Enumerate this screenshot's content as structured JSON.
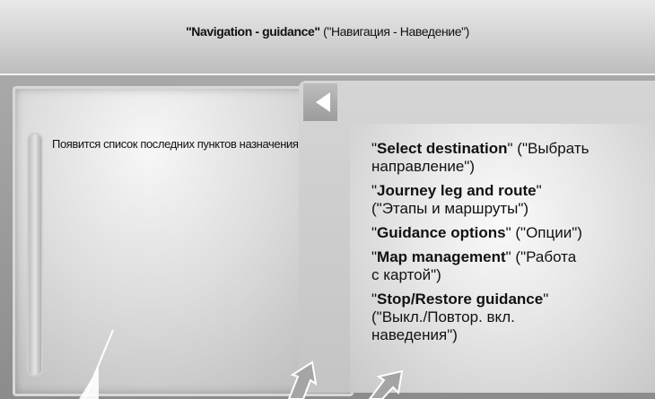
{
  "header": {
    "title_main": "\"Navigation - guidance\"",
    "title_sub": "(\"Навигация - Наведение\")"
  },
  "left_panel": {
    "text": "Появится список последних пунктов назначения."
  },
  "menu": {
    "items": [
      {
        "key": "Select destination",
        "line1_tail": " (\"Выбрать",
        "line2": "направление\")"
      },
      {
        "key": "Journey leg and route",
        "line1_tail": "",
        "line2": "(\"Этапы и маршруты\")"
      },
      {
        "key": "Guidance options",
        "line1_tail": " (\"Опции\")",
        "line2": ""
      },
      {
        "key": "Map management",
        "line1_tail": " (\"Работа",
        "line2": "с картой\")"
      },
      {
        "key": "Stop/Restore guidance",
        "line1_tail": "",
        "line2": "(\"Выкл./Повтор. вкл.",
        "line3": "наведения\")"
      }
    ]
  },
  "icons": {
    "back": "left-triangle-icon"
  }
}
